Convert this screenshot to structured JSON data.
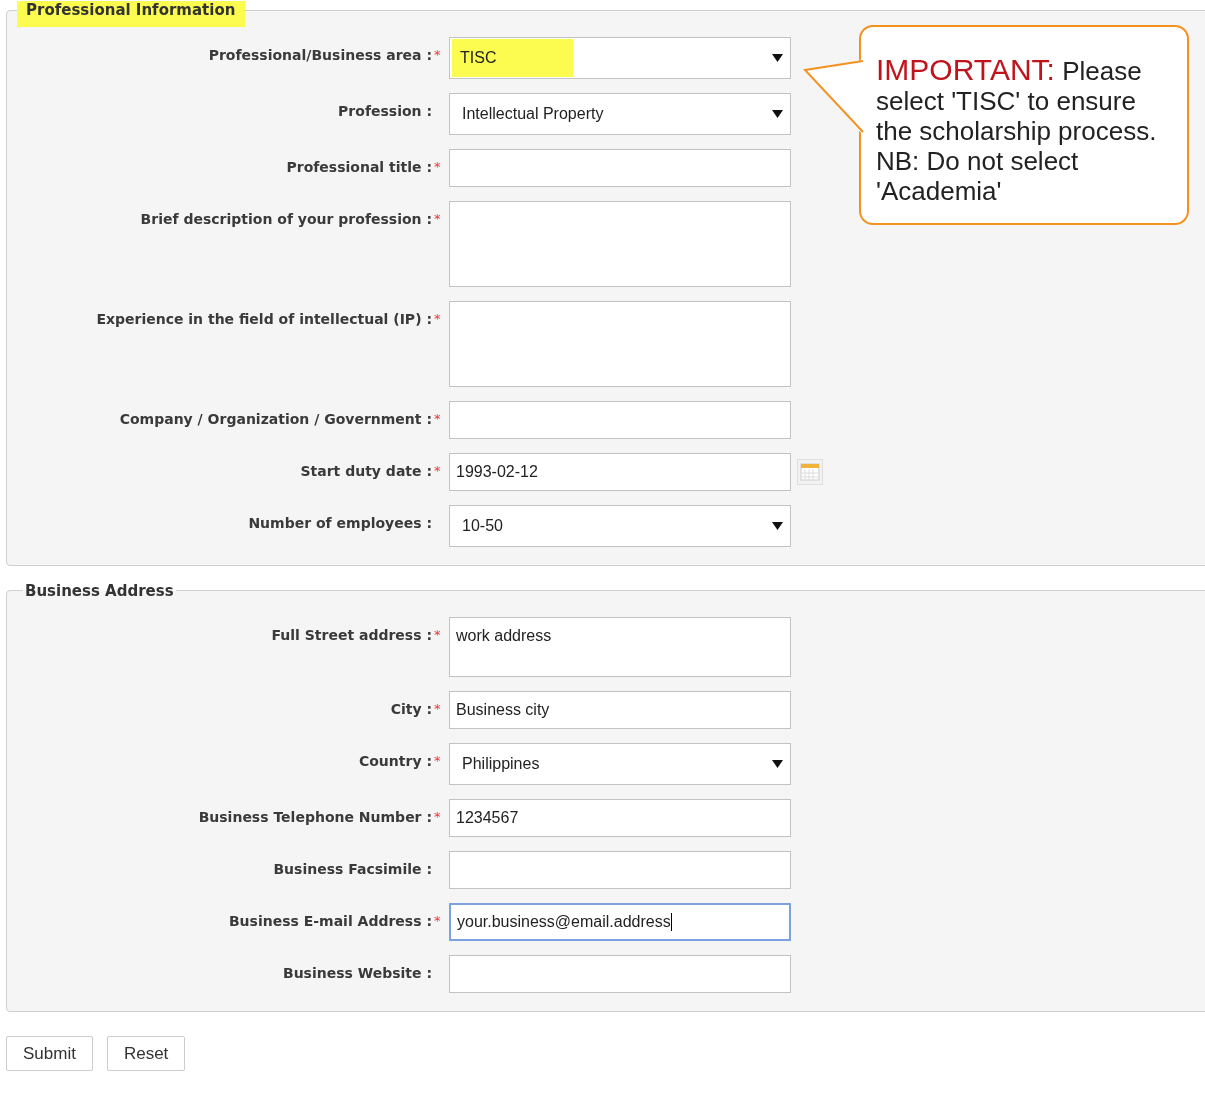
{
  "sections": [
    {
      "legend": "Professional Information",
      "highlighted": true,
      "fields": [
        {
          "kind": "select",
          "label": "Professional/Business area :",
          "marker": "*",
          "value": "TISC",
          "highlighted": true
        },
        {
          "kind": "select",
          "label": "Profession :",
          "value": "Intellectual Property"
        },
        {
          "kind": "text",
          "label": "Professional title :",
          "marker": "*"
        },
        {
          "kind": "textarea",
          "label": "Brief description of your profession :",
          "marker": "*"
        },
        {
          "kind": "textarea",
          "label": "Experience in the field of intellectual (IP) :",
          "marker": "*"
        },
        {
          "kind": "text",
          "label": "Company / Organization / Government :",
          "marker": "*"
        },
        {
          "kind": "date",
          "label": "Start duty date :",
          "marker": "*",
          "value": "1993-02-12"
        },
        {
          "kind": "select",
          "label": "Number of employees :",
          "value": "10-50"
        }
      ]
    },
    {
      "legend": "Business Address",
      "highlighted": false,
      "fields": [
        {
          "kind": "textarea",
          "label": "Full Street address :",
          "marker": "*",
          "value": "work address"
        },
        {
          "kind": "text",
          "label": "City :",
          "marker": "*",
          "value": "Business city"
        },
        {
          "kind": "select",
          "label": "Country :",
          "marker": "*",
          "value": "Philippines"
        },
        {
          "kind": "text",
          "label": "Business Telephone Number :",
          "marker": "*",
          "value": "1234567"
        },
        {
          "kind": "text",
          "label": "Business Facsimile :"
        },
        {
          "kind": "text",
          "label": "Business E-mail Address :",
          "marker": "*",
          "value": "your.business@email.address",
          "focused": true
        },
        {
          "kind": "text",
          "label": "Business Website :"
        }
      ]
    }
  ],
  "callout": {
    "heading": "IMPORTANT:",
    "text": "Please select 'TISC' to ensure the scholarship process. NB: Do not select 'Academia'"
  },
  "buttons": [
    "Submit",
    "Reset"
  ]
}
